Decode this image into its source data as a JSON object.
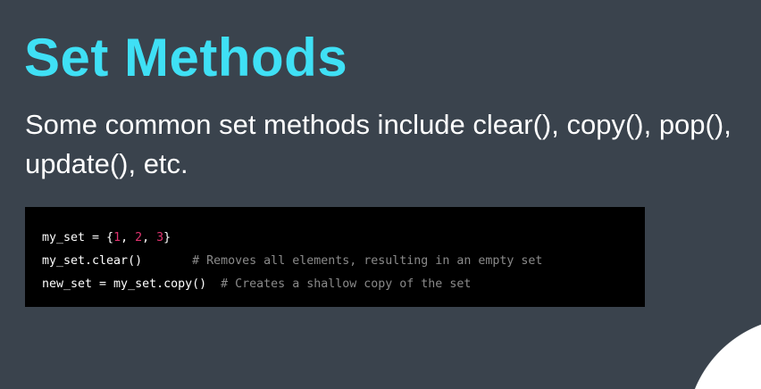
{
  "colors": {
    "accent": "#3fe0f5",
    "background": "#3a434d",
    "number": "#e0336f",
    "comment": "#8a8a8a"
  },
  "slide": {
    "title": "Set Methods",
    "subtitle": "Some common set methods include clear(), copy(), pop(), update(), etc."
  },
  "code": {
    "line1": {
      "pre": "my_set = {",
      "n1": "1",
      "s1": ", ",
      "n2": "2",
      "s2": ", ",
      "n3": "3",
      "post": "}"
    },
    "line2": {
      "code": "my_set.clear()       ",
      "comment": "# Removes all elements, resulting in an empty set"
    },
    "line3": {
      "code": "new_set = my_set.copy()  ",
      "comment": "# Creates a shallow copy of the set"
    }
  }
}
